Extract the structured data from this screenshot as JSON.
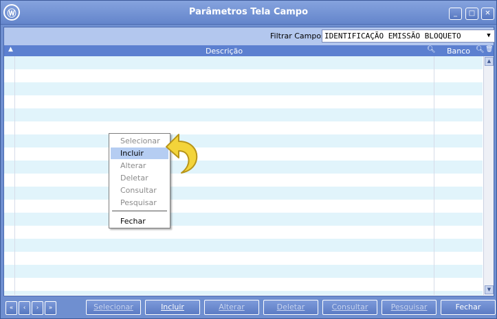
{
  "window": {
    "title": "Parâmetros Tela Campo",
    "logo_glyph": "Ⓦ",
    "controls": {
      "minimize": "_",
      "maximize": "□",
      "close": "✕"
    }
  },
  "filter": {
    "label": "Filtrar Campos:",
    "selected": "IDENTIFICAÇÃO EMISSÃO BLOQUETO"
  },
  "grid": {
    "columns": [
      "Descrição",
      "Banco"
    ],
    "rows": []
  },
  "context_menu": {
    "items": [
      {
        "label": "Selecionar",
        "enabled": false
      },
      {
        "label": "Incluir",
        "enabled": true,
        "hover": true
      },
      {
        "label": "Alterar",
        "enabled": false
      },
      {
        "label": "Deletar",
        "enabled": false
      },
      {
        "label": "Consultar",
        "enabled": false
      },
      {
        "label": "Pesquisar",
        "enabled": false
      },
      {
        "label": "Fechar",
        "enabled": true
      }
    ]
  },
  "navigation": {
    "first": "«",
    "prev": "‹",
    "next": "›",
    "last": "»"
  },
  "actions": {
    "selecionar": "Selecionar",
    "incluir": "Incluir",
    "alterar": "Alterar",
    "deletar": "Deletar",
    "consultar": "Consultar",
    "pesquisar": "Pesquisar",
    "fechar": "Fechar"
  },
  "colors": {
    "window_bg": "#6f8fd0",
    "header_bg": "#5c80d0",
    "row_alt": "#e1f4fb",
    "menu_hover": "#b5cdf2",
    "arrow_yellow": "#f3d43a"
  }
}
